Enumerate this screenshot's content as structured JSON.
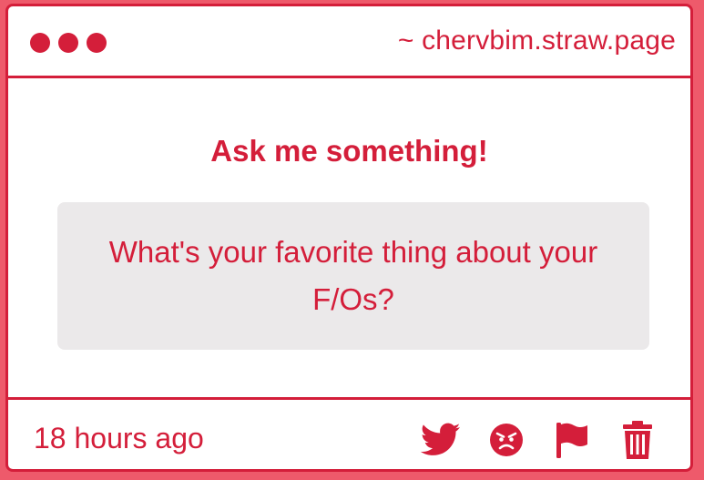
{
  "window": {
    "url": "~ chervbim.straw.page"
  },
  "main": {
    "heading": "Ask me something!",
    "question": "What's your favorite thing about your F/Os?"
  },
  "footer": {
    "time": "18 hours ago",
    "actions": [
      "twitter-icon",
      "angry-face-icon",
      "flag-icon",
      "trash-icon"
    ]
  },
  "colors": {
    "accent": "#d41e3a",
    "background": "#ee5a6b",
    "question_box": "#ebe9ea"
  }
}
